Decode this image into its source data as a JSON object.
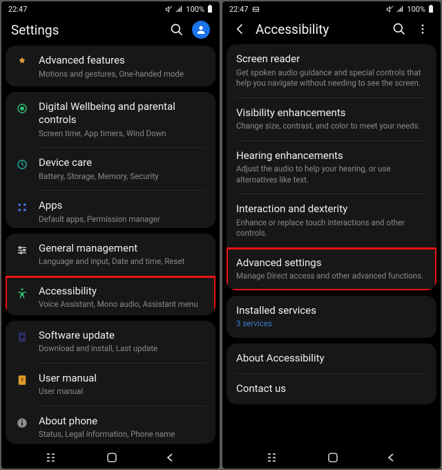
{
  "status": {
    "time": "22:47",
    "pct": "100%"
  },
  "left": {
    "title": "Settings",
    "groups": [
      {
        "rows": [
          {
            "icon": "advanced-features-icon",
            "col": "#e8a33a",
            "title": "Advanced features",
            "sub": "Motions and gestures, One-handed mode"
          }
        ]
      },
      {
        "rows": [
          {
            "icon": "wellbeing-icon",
            "col": "#2bbd6e",
            "title": "Digital Wellbeing and parental controls",
            "sub": "Screen time, App timers, Wind Down"
          },
          {
            "icon": "device-care-icon",
            "col": "#1fa8a0",
            "title": "Device care",
            "sub": "Battery, Storage, Memory, Security"
          },
          {
            "icon": "apps-icon",
            "col": "#4a6fe0",
            "title": "Apps",
            "sub": "Default apps, Permission manager"
          }
        ]
      },
      {
        "rows": [
          {
            "icon": "general-mgmt-icon",
            "col": "#bdbdbd",
            "title": "General management",
            "sub": "Language and input, Date and time, Reset"
          },
          {
            "icon": "accessibility-icon",
            "col": "#2bbd6e",
            "title": "Accessibility",
            "sub": "Voice Assistant, Mono audio, Assistant menu",
            "hl": true
          }
        ]
      },
      {
        "rows": [
          {
            "icon": "software-update-icon",
            "col": "#5b5fff",
            "title": "Software update",
            "sub": "Download and install, Last update"
          },
          {
            "icon": "user-manual-icon",
            "col": "#e09a2a",
            "title": "User manual",
            "sub": "User manual"
          },
          {
            "icon": "about-phone-icon",
            "col": "#8f8f8f",
            "title": "About phone",
            "sub": "Status, Legal information, Phone name"
          }
        ]
      }
    ]
  },
  "right": {
    "title": "Accessibility",
    "groups": [
      {
        "rows": [
          {
            "title": "Screen reader",
            "sub": "Get spoken audio guidance and special controls that help you navigate without needing to see the screen."
          },
          {
            "title": "Visibility enhancements",
            "sub": "Change size, contrast, and color to meet your needs."
          },
          {
            "title": "Hearing enhancements",
            "sub": "Adjust the audio to help your hearing, or use alternatives like text."
          },
          {
            "title": "Interaction and dexterity",
            "sub": "Enhance or replace touch interactions and other controls."
          },
          {
            "title": "Advanced settings",
            "sub": "Manage Direct access and other advanced functions.",
            "hl": true
          }
        ]
      },
      {
        "rows": [
          {
            "title": "Installed services",
            "sub": "3 services",
            "link": true
          }
        ]
      },
      {
        "rows": [
          {
            "title": "About Accessibility"
          },
          {
            "title": "Contact us"
          }
        ]
      }
    ]
  }
}
